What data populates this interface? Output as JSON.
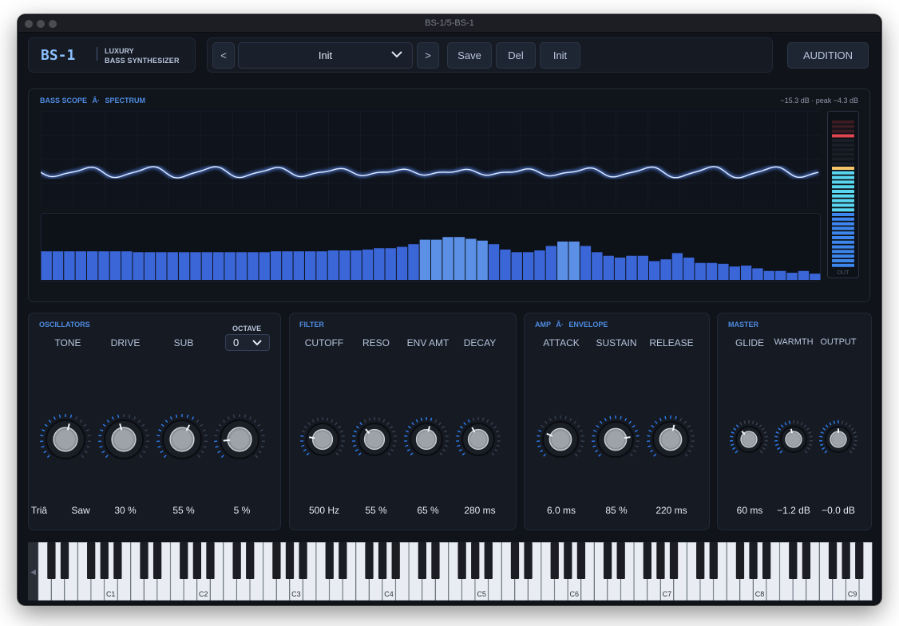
{
  "window": {
    "title": "BS-1/5-BS-1"
  },
  "brand": {
    "logo": "BS-1",
    "line1": "LUXURY",
    "line2": "BASS SYNTHESIZER"
  },
  "toolbar": {
    "prev_label": "<",
    "preset_name": "Init",
    "next_label": ">",
    "save_label": "Save",
    "del_label": "Del",
    "init_label": "Init",
    "audition_label": "AUDITION"
  },
  "scope": {
    "title_part1": "BASS SCOPE",
    "title_sep": "Â·",
    "title_part2": "SPECTRUM",
    "readout": "−15.3 dB · peak −4.3 dB",
    "meter_label": "OUT",
    "spectrum_levels": [
      0.64,
      0.64,
      0.64,
      0.64,
      0.64,
      0.64,
      0.64,
      0.64,
      0.62,
      0.62,
      0.62,
      0.62,
      0.62,
      0.62,
      0.62,
      0.62,
      0.62,
      0.62,
      0.62,
      0.62,
      0.64,
      0.64,
      0.64,
      0.64,
      0.64,
      0.66,
      0.66,
      0.66,
      0.68,
      0.71,
      0.71,
      0.74,
      0.8,
      0.9,
      0.9,
      0.96,
      0.96,
      0.92,
      0.88,
      0.8,
      0.68,
      0.62,
      0.62,
      0.66,
      0.76,
      0.86,
      0.86,
      0.76,
      0.62,
      0.54,
      0.5,
      0.54,
      0.54,
      0.42,
      0.46,
      0.6,
      0.5,
      0.38,
      0.38,
      0.36,
      0.3,
      0.32,
      0.26,
      0.2,
      0.2,
      0.16,
      0.2,
      0.14
    ]
  },
  "sections": {
    "oscillators": {
      "title": "OSCILLATORS",
      "octave_label": "OCTAVE",
      "octave_value": "0",
      "knobs": [
        {
          "label": "TONE",
          "value_a": "Triâ",
          "value_b": "Saw"
        },
        {
          "label": "DRIVE",
          "value": "30 %"
        },
        {
          "label": "SUB",
          "value": "55 %"
        },
        {
          "label": "",
          "value": "5 %"
        }
      ]
    },
    "filter": {
      "title": "FILTER",
      "knobs": [
        {
          "label": "CUTOFF",
          "value": "500 Hz"
        },
        {
          "label": "RESO",
          "value": "55 %"
        },
        {
          "label": "ENV AMT",
          "value": "65 %"
        },
        {
          "label": "DECAY",
          "value": "280 ms"
        }
      ]
    },
    "amp": {
      "title_part1": "AMP",
      "title_sep": "Â·",
      "title_part2": "ENVELOPE",
      "knobs": [
        {
          "label": "ATTACK",
          "value": "6.0 ms"
        },
        {
          "label": "SUSTAIN",
          "value": "85 %"
        },
        {
          "label": "RELEASE",
          "value": "220 ms"
        }
      ]
    },
    "master": {
      "title": "MASTER",
      "knobs": [
        {
          "label": "GLIDE",
          "value": "60 ms"
        },
        {
          "label": "WARMTH",
          "value": "−1.2 dB"
        },
        {
          "label": "OUTPUT",
          "value": "−0.0 dB"
        }
      ]
    }
  },
  "keyboard": {
    "octave_labels": [
      "C1",
      "C2",
      "C3",
      "C4",
      "C5",
      "C6",
      "C7",
      "C8",
      "C9"
    ],
    "scroll_left_glyph": "◀"
  },
  "colors": {
    "accent": "#4f8be0",
    "bg": "#101319",
    "panel": "#151a23",
    "meter_red": "#e0454f",
    "meter_amber": "#f3c46a",
    "meter_cyan": "#5ad7f0"
  }
}
